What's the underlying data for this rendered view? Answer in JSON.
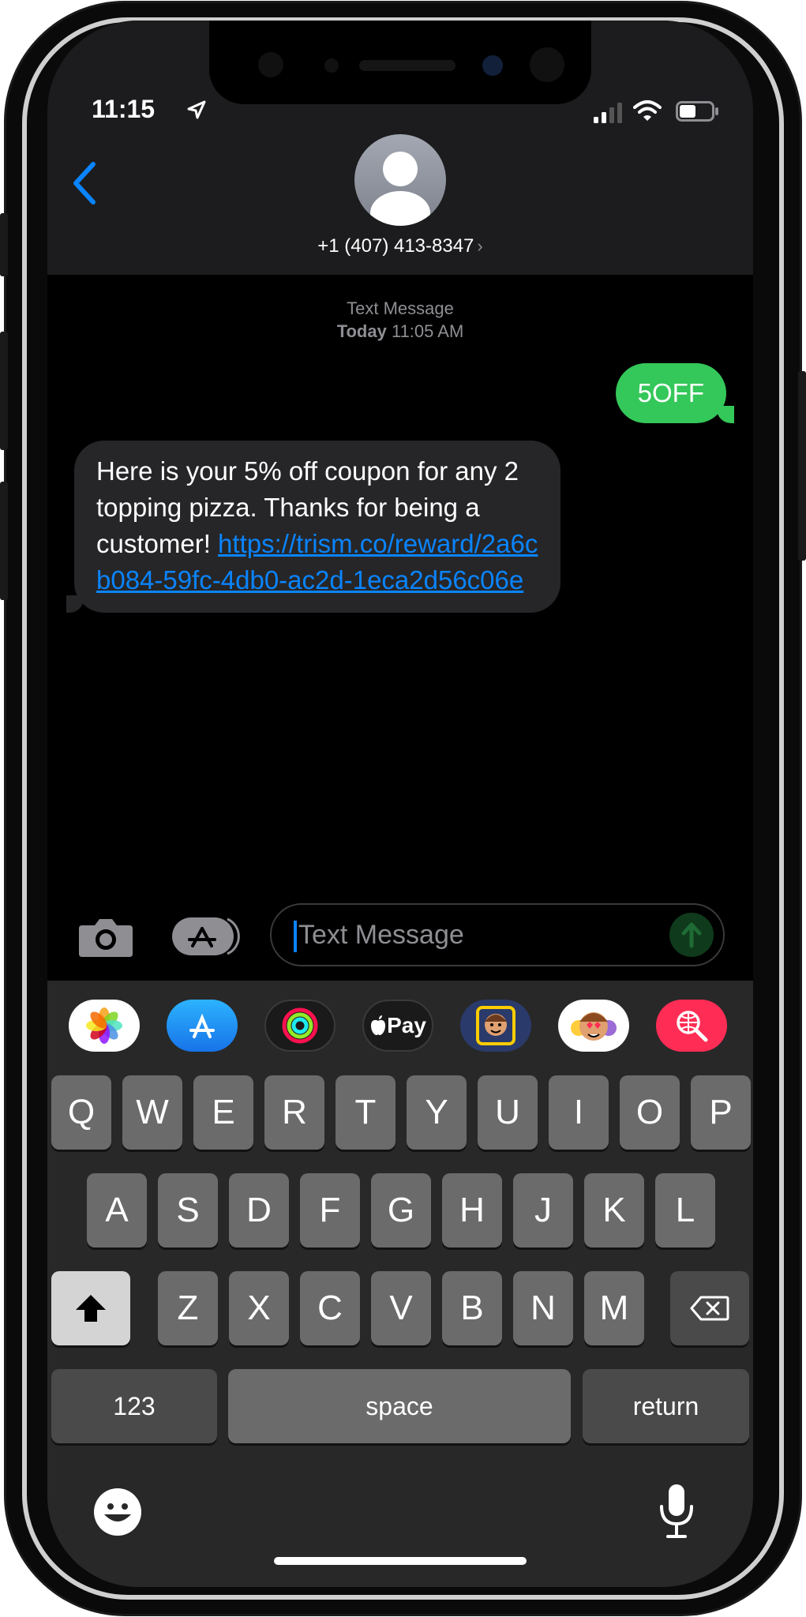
{
  "status_bar": {
    "time": "11:15"
  },
  "header": {
    "contact": "+1 (407) 413-8347",
    "chevron": "›"
  },
  "thread": {
    "label": "Text Message",
    "day": "Today",
    "time": "11:05 AM",
    "messages": [
      {
        "direction": "outgoing",
        "text": "5OFF"
      },
      {
        "direction": "incoming",
        "text": "Here is your 5% off coupon for any 2 topping pizza. Thanks for being a customer! ",
        "link": "https://trism.co/reward/2a6cb084-59fc-4db0-ac2d-1eca2d56c06e"
      }
    ]
  },
  "composer": {
    "placeholder": "Text Message"
  },
  "app_strip": [
    {
      "name": "photos-app-icon"
    },
    {
      "name": "app-store-icon"
    },
    {
      "name": "activity-rings-icon"
    },
    {
      "name": "apple-pay-icon",
      "label": "Pay"
    },
    {
      "name": "memoji-camera-icon"
    },
    {
      "name": "memoji-stickers-icon"
    },
    {
      "name": "image-search-icon"
    }
  ],
  "keyboard": {
    "row1": [
      "Q",
      "W",
      "E",
      "R",
      "T",
      "Y",
      "U",
      "I",
      "O",
      "P"
    ],
    "row2": [
      "A",
      "S",
      "D",
      "F",
      "G",
      "H",
      "J",
      "K",
      "L"
    ],
    "row3": [
      "Z",
      "X",
      "C",
      "V",
      "B",
      "N",
      "M"
    ],
    "numbers_label": "123",
    "space_label": "space",
    "return_label": "return"
  },
  "colors": {
    "accent_blue": "#0a84ff",
    "outgoing_bubble": "#34c759",
    "incoming_bubble": "#262628",
    "key": "#6b6b6b",
    "keyboard_bg": "#282828"
  }
}
